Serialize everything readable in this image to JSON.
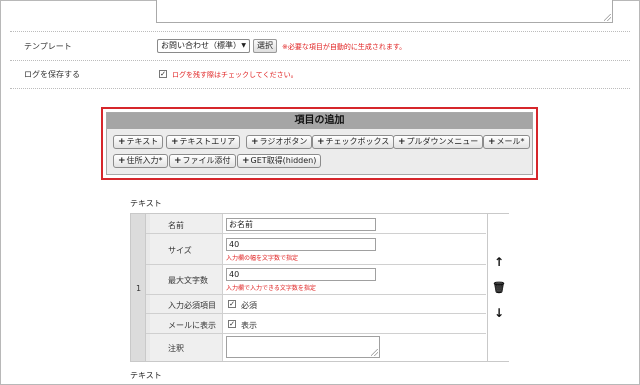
{
  "template_row": {
    "label": "テンプレート",
    "select_value": "お問い合わせ（標準）",
    "select_button": "選択",
    "note": "※必要な項目が自動的に生成されます。"
  },
  "log_row": {
    "label": "ログを保存する",
    "checkbox_note": "ログを残す際はチェックしてください。"
  },
  "add_panel": {
    "title": "項目の追加",
    "buttons_row1": [
      "テキスト",
      "テキストエリア",
      "ラジオボタン",
      "チェックボックス",
      "プルダウンメニュー",
      "メール*"
    ],
    "buttons_row2": [
      "住所入力*",
      "ファイル添付",
      "GET取得(hidden)"
    ]
  },
  "field_section": {
    "title": "テキスト",
    "number": "1",
    "rows": {
      "name": {
        "label": "名前",
        "value": "お名前"
      },
      "size": {
        "label": "サイズ",
        "value": "40",
        "hint": "入力欄の幅を文字数で指定"
      },
      "maxlen": {
        "label": "最大文字数",
        "value": "40",
        "hint": "入力欄で入力できる文字数を指定"
      },
      "required": {
        "label": "入力必須項目",
        "check_label": "必須"
      },
      "show_mail": {
        "label": "メールに表示",
        "check_label": "表示"
      },
      "note": {
        "label": "注釈"
      }
    },
    "controls": {
      "up": "↑",
      "delete": "🗑",
      "down": "↓"
    }
  },
  "next_section": {
    "title": "テキスト"
  }
}
